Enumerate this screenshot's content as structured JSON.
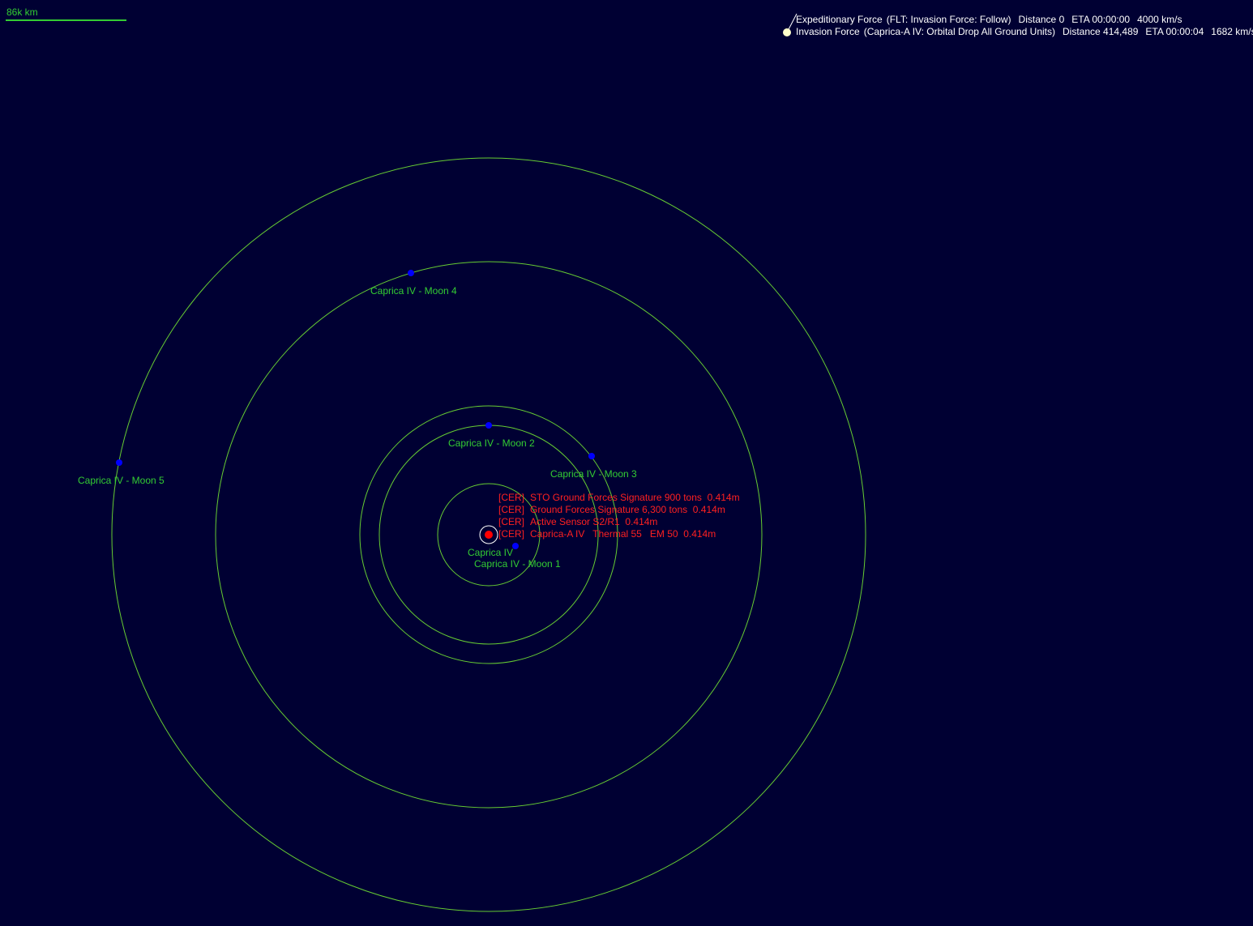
{
  "scale": {
    "label": "86k km"
  },
  "fleets": [
    {
      "name": "Expeditionary Force",
      "order": "(FLT: Invasion Force: Follow)",
      "distance": "Distance 0",
      "eta": "ETA 00:00:00",
      "speed": "4000 km/s"
    },
    {
      "name": "Invasion Force",
      "order": "(Caprica-A IV: Orbital Drop All Ground Units)",
      "distance": "Distance 414,489",
      "eta": "ETA 00:00:04",
      "speed": "1682 km/s"
    }
  ],
  "planet": {
    "name": "Caprica IV"
  },
  "moons": [
    {
      "name": "Caprica IV - Moon 1"
    },
    {
      "name": "Caprica IV - Moon 2"
    },
    {
      "name": "Caprica IV - Moon 3"
    },
    {
      "name": "Caprica IV - Moon 4"
    },
    {
      "name": "Caprica IV - Moon 5"
    }
  ],
  "contacts": [
    {
      "tag": "[CER]",
      "text": "STO Ground Forces Signature 900 tons  0.414m"
    },
    {
      "tag": "[CER]",
      "text": "Ground Forces Signature 6,300 tons  0.414m"
    },
    {
      "tag": "[CER]",
      "text": "Active Sensor S2/R1  0.414m"
    },
    {
      "tag": "[CER]",
      "text": "Caprica-A IV   Thermal 55   EM 50  0.414m"
    }
  ],
  "colors": {
    "background": "#000033",
    "orbit": "#66CC33",
    "label": "#33CC33",
    "moon": "#0000FF",
    "planet": "#FF0000",
    "contact": "#FF2020",
    "fleet_text": "#FFFFFF",
    "fleet_marker": "#FFFFCC"
  }
}
